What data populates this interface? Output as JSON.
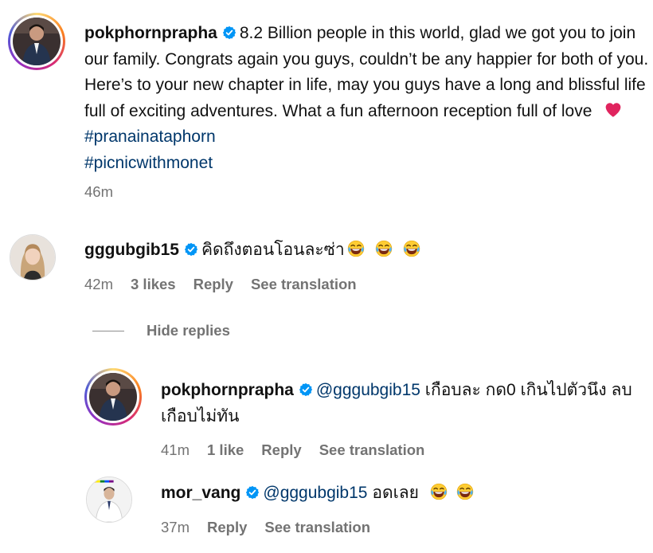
{
  "comments": [
    {
      "username": "pokphornprapha",
      "text": "8.2 Billion people in this world, glad we got you to join our family. Congrats again you guys, couldn’t be any happier for both of you. Here’s to your new chapter in life, may you guys have a long and blissful life full of exciting adventures. What a fun afternoon reception full of love",
      "hashtags": [
        "#pranainataphorn",
        "#picnicwithmonet"
      ],
      "time": "46m"
    },
    {
      "username": "gggubgib15",
      "text": "คิดถึงตอนโอนละซ่า",
      "time": "42m",
      "likes": "3 likes",
      "reply": "Reply",
      "translate": "See translation"
    }
  ],
  "hide_replies": "Hide replies",
  "replies": [
    {
      "username": "pokphornprapha",
      "mention": "@gggubgib15",
      "text": "เกือบละ กด0 เกินไปตัวนึง ลบเกือบไม่ทัน",
      "time": "41m",
      "likes": "1 like",
      "reply": "Reply",
      "translate": "See translation"
    },
    {
      "username": "mor_vang",
      "mention": "@gggubgib15",
      "text": "อดเลย",
      "time": "37m",
      "reply": "Reply",
      "translate": "See translation"
    }
  ],
  "icons": {
    "verified": "verified-badge-icon",
    "heart": "red-heart-icon",
    "laugh": "face-with-tears-of-joy-icon"
  },
  "colors": {
    "verified_blue": "#0095f6",
    "link_blue": "#00376b",
    "meta_gray": "#737373",
    "heart_red": "#e0245e"
  }
}
